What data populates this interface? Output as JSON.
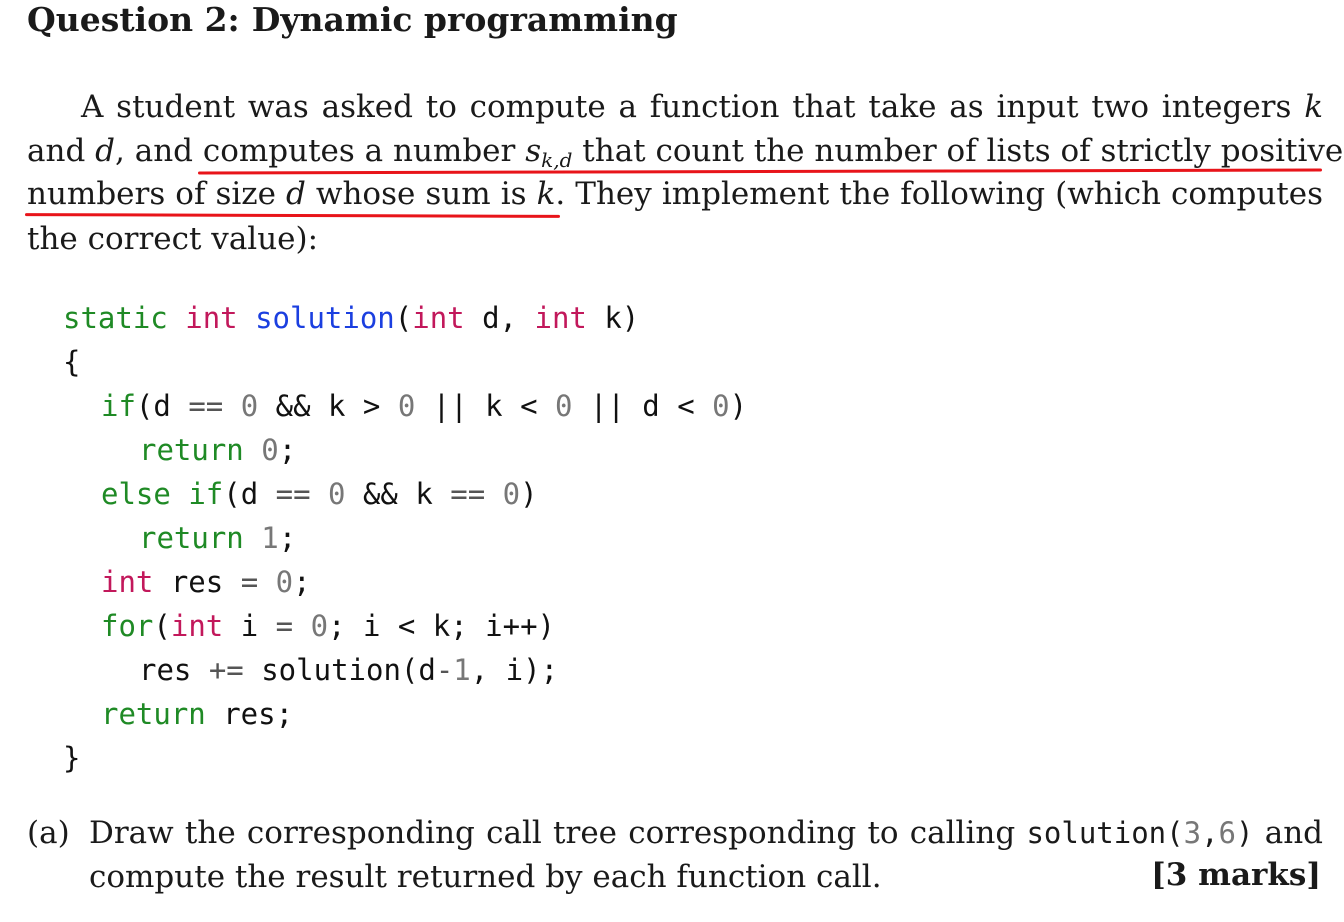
{
  "heading": {
    "number": "Question 2:",
    "title": "Dynamic programming"
  },
  "paragraph": {
    "line1": "A student was asked to compute a function that take as input two integers",
    "line1_var": "k",
    "line2_pre": "and",
    "line2_var": "d",
    "line2_mid": ", and computes a number",
    "line2_s": "s",
    "line2_sub": "k,d",
    "line2_post": "that count the number of lists of strictly positive",
    "line3_pre": "numbers of size",
    "line3_var": "d",
    "line3_mid": "whose sum is",
    "line3_var2": "k",
    "line3_post": ". They implement the following (which computes",
    "line4": "the correct value):"
  },
  "annotation": {
    "color": "#e8141a"
  },
  "code": {
    "l1_static": "static",
    "l1_int": "int",
    "l1_fn": "solution",
    "l1_p1": "(",
    "l1_int2": "int",
    "l1_d": " d, ",
    "l1_int3": "int",
    "l1_k": " k)",
    "l2": "{",
    "l3_if": "if",
    "l3_a": "(d ",
    "l3_op1": "==",
    "l3_n1": " 0 ",
    "l3_b": "&& k > ",
    "l3_n2": "0",
    "l3_c": " || k < ",
    "l3_n3": "0",
    "l3_d": " || d < ",
    "l3_n4": "0",
    "l3_e": ")",
    "l4_return": "return",
    "l4_n": " 0",
    "l4_e": ";",
    "l5_else": "else",
    "l5_if": "if",
    "l5_a": "(d ",
    "l5_op1": "==",
    "l5_n1": " 0 ",
    "l5_b": "&& k ",
    "l5_op2": "==",
    "l5_n2": " 0",
    "l5_e": ")",
    "l6_return": "return",
    "l6_n": " 1",
    "l6_e": ";",
    "l7_int": "int",
    "l7_a": " res ",
    "l7_op": "=",
    "l7_n": " 0",
    "l7_e": ";",
    "l8_for": "for",
    "l8_p": "(",
    "l8_int": "int",
    "l8_a": " i ",
    "l8_op": "=",
    "l8_n": " 0",
    "l8_b": "; i < k; i++)",
    "l9_a": "res ",
    "l9_op": "+=",
    "l9_b": " solution(d",
    "l9_op2": "-",
    "l9_n": "1",
    "l9_c": ", i);",
    "l10_return": "return",
    "l10_a": " res;",
    "l11": "}"
  },
  "part_a": {
    "label": "(a)",
    "text1": "Draw the corresponding call tree corresponding to calling",
    "call_fn": "solution(",
    "call_n1": "3",
    "call_comma": ",",
    "call_n2": "6",
    "call_close": ")",
    "text1_end": "and",
    "text2": "compute the result returned by each function call.",
    "marks": "[3 marks]"
  }
}
